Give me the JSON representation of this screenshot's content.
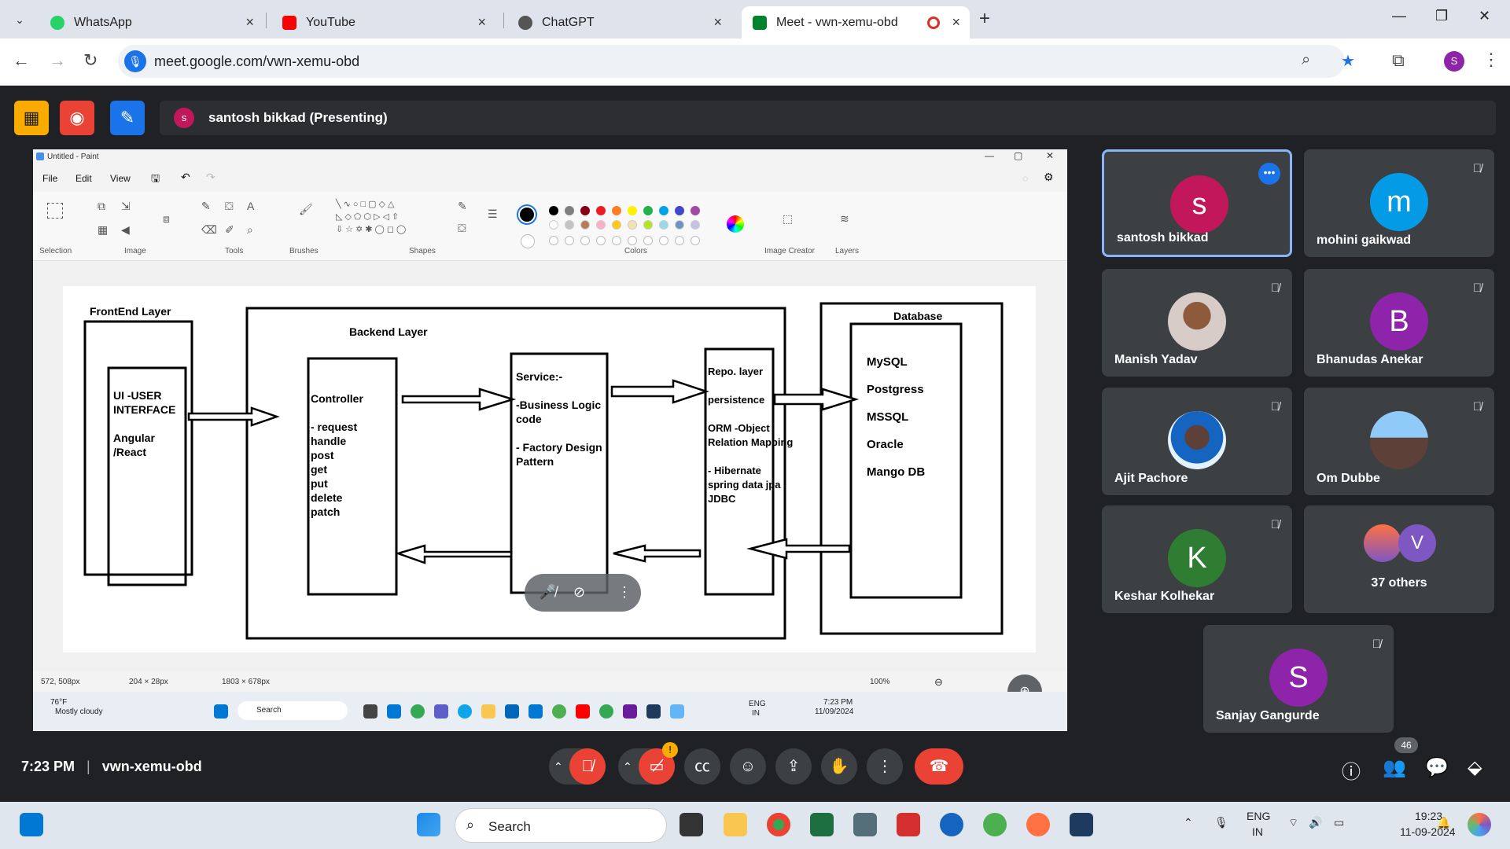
{
  "browser": {
    "tabs": [
      {
        "label": "WhatsApp",
        "color": "#25d366",
        "icon": "whatsapp-icon"
      },
      {
        "label": "YouTube",
        "color": "#ff0000",
        "icon": "youtube-icon"
      },
      {
        "label": "ChatGPT",
        "color": "#444444",
        "icon": "chatgpt-icon"
      },
      {
        "label": "Meet - vwn-xemu-obd",
        "color": "#00832d",
        "icon": "meet-icon"
      }
    ],
    "url": "meet.google.com/vwn-xemu-obd",
    "profile_initial": "S"
  },
  "meet": {
    "presenting_label": "santosh bikkad (Presenting)",
    "presenter_initial": "s",
    "time": "7:23 PM",
    "meeting_code": "vwn-xemu-obd",
    "participant_count": "46",
    "participants": [
      {
        "name": "santosh bikkad",
        "initial": "s",
        "color": "#c2185b"
      },
      {
        "name": "mohini gaikwad",
        "initial": "m",
        "color": "#039be5"
      },
      {
        "name": "Manish Yadav"
      },
      {
        "name": "Bhanudas Anekar",
        "initial": "B",
        "color": "#8e24aa"
      },
      {
        "name": "Ajit Pachore"
      },
      {
        "name": "Om Dubbe"
      },
      {
        "name": "Keshar Kolhekar",
        "initial": "K",
        "color": "#2e7d32"
      },
      {
        "name": "37 others",
        "initial": "V",
        "color": "#7e57c2"
      },
      {
        "name": "Sanjay Gangurde",
        "initial": "S",
        "color": "#8e24aa"
      }
    ]
  },
  "paint": {
    "title": "Untitled - Paint",
    "menu": [
      "File",
      "Edit",
      "View"
    ],
    "groups": [
      "Selection",
      "Image",
      "Tools",
      "Brushes",
      "Shapes",
      "Colors",
      "Image Creator",
      "Layers"
    ],
    "status": {
      "cursor": "572, 508px",
      "selection": "204 × 28px",
      "canvas": "1803 × 678px",
      "zoom": "100%"
    },
    "diagram": {
      "frontend_title": "FrontEnd Layer",
      "ui_text": [
        "UI -USER",
        "INTERFACE",
        "",
        "Angular",
        "/React"
      ],
      "backend_title": "Backend Layer",
      "controller_text": [
        "Controller",
        "",
        "- request",
        "handle",
        "post",
        "get",
        "put",
        "delete",
        "patch"
      ],
      "service_text": [
        "Service:-",
        "",
        "-Business Logic",
        "code",
        "",
        "- Factory Design",
        "Pattern"
      ],
      "repo_text": [
        "Repo. layer",
        "",
        "persistence",
        "",
        "ORM -Object",
        "Relation Mapping",
        "",
        "- Hibernate",
        " spring data jpa",
        " JDBC"
      ],
      "database_title": "Database",
      "db_text": [
        "MySQL",
        "Postgress",
        "MSSQL",
        "Oracle",
        "Mango DB"
      ]
    },
    "inner_taskbar": {
      "weather_temp": "76°F",
      "weather_desc": "Mostly cloudy",
      "search": "Search",
      "lang1": "ENG",
      "lang2": "IN",
      "time": "7:23 PM",
      "date": "11/09/2024"
    }
  },
  "taskbar": {
    "search": "Search",
    "lang1": "ENG",
    "lang2": "IN",
    "time": "19:23",
    "date": "11-09-2024"
  }
}
